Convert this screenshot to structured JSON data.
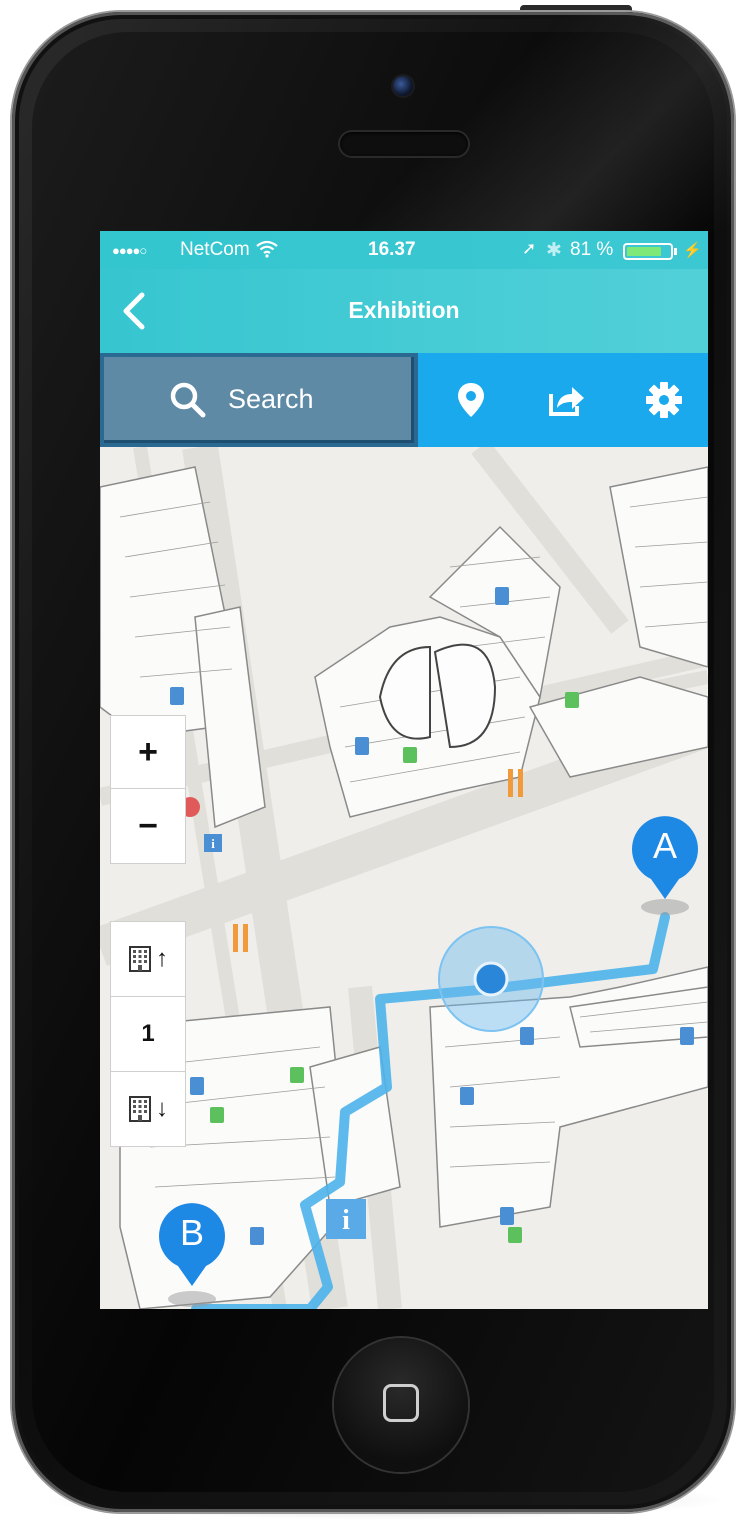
{
  "status_bar": {
    "signal": "●●●●○",
    "carrier": "NetCom",
    "wifi_icon": "wifi-icon",
    "time": "16.37",
    "location_arrow": "➚",
    "bluetooth": "✱",
    "battery_percent": "81 %",
    "battery_level": 0.81,
    "charging": "⚡"
  },
  "nav": {
    "title": "Exhibition",
    "back_icon": "chevron-left-icon"
  },
  "toolbar": {
    "search_label": "Search",
    "icons": [
      "search-icon",
      "location-pin-icon",
      "share-icon",
      "gear-icon"
    ]
  },
  "map_controls": {
    "zoom_in": "+",
    "zoom_out": "−",
    "floor_up_arrow": "↑",
    "floor_current": "1",
    "floor_down_arrow": "↓"
  },
  "markers": {
    "start": "A",
    "end": "B"
  },
  "colors": {
    "header": "#36c6d0",
    "toolbar": "#1aa9ec",
    "search_box": "#5f8aa6",
    "route": "#4cb3ea",
    "marker": "#1e88e5"
  }
}
